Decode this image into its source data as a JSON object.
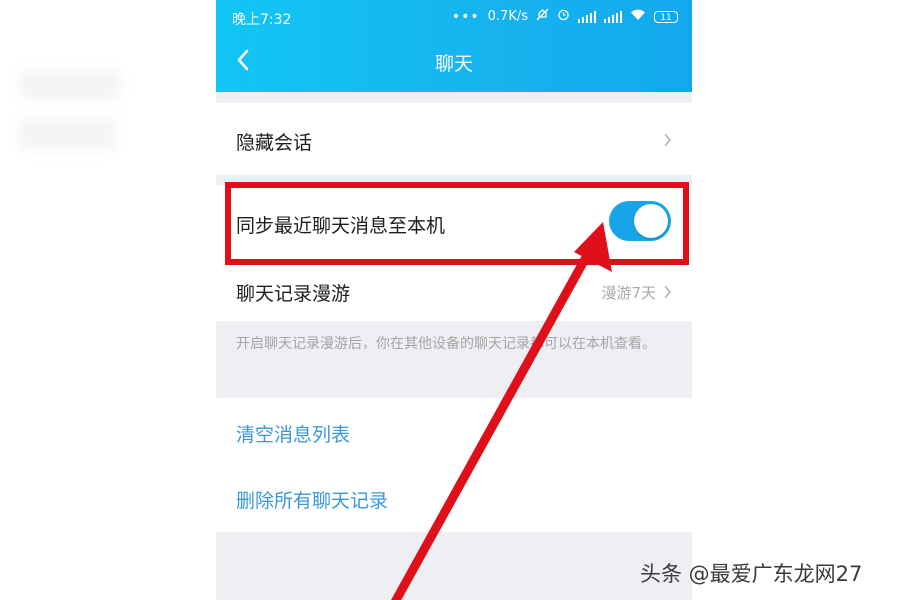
{
  "status_bar": {
    "time": "晚上7:32",
    "dots": "•••",
    "network_speed": "0.7K/s",
    "battery": "11"
  },
  "nav": {
    "title": "聊天"
  },
  "settings": {
    "hidden_sessions": "隐藏会话",
    "sync_recent": "同步最近聊天消息至本机",
    "sync_enabled": true,
    "roaming_label": "聊天记录漫游",
    "roaming_value": "漫游7天",
    "roaming_hint": "开启聊天记录漫游后，你在其他设备的聊天记录都可以在本机查看。",
    "clear_list": "清空消息列表",
    "delete_all": "删除所有聊天记录"
  },
  "annotation": {
    "highlight_color": "#e0101a"
  },
  "watermark": "头条 @最爱广东龙网27",
  "colors": {
    "header": "#16b4ef",
    "toggle_on": "#17a4e8",
    "link_blue": "#3a98d8"
  }
}
